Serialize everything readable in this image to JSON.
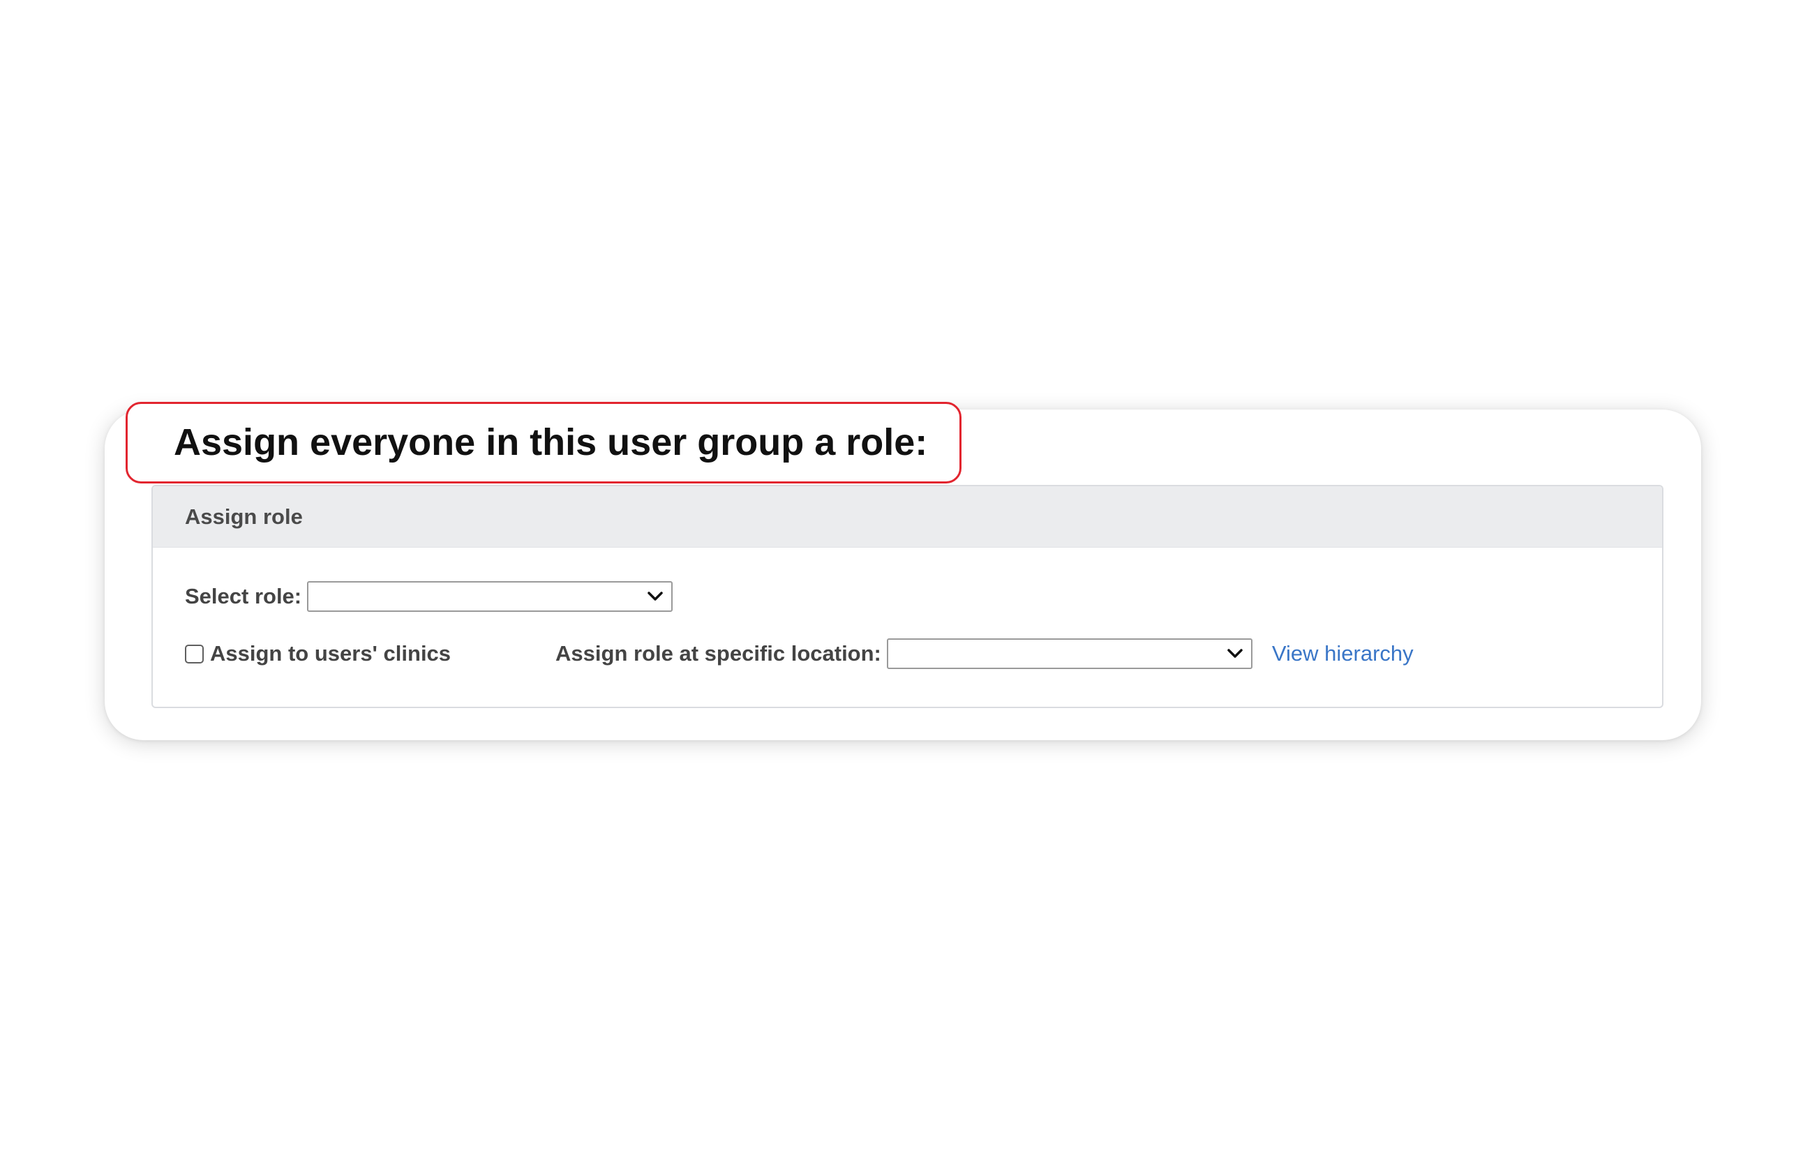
{
  "callout": {
    "text": "Assign everyone in this user group a role:"
  },
  "panel": {
    "title": "Assign role",
    "select_role_label": "Select role:",
    "select_role_value": "",
    "assign_clinics_label": "Assign to users' clinics",
    "assign_clinics_checked": false,
    "location_label": "Assign role at specific location:",
    "location_value": "",
    "view_hierarchy_link": "View hierarchy"
  },
  "colors": {
    "callout_border": "#e2252f",
    "link": "#3a76c7",
    "header_bg": "#ebecee"
  },
  "icons": {
    "dropdown": "chevron-down-icon"
  }
}
